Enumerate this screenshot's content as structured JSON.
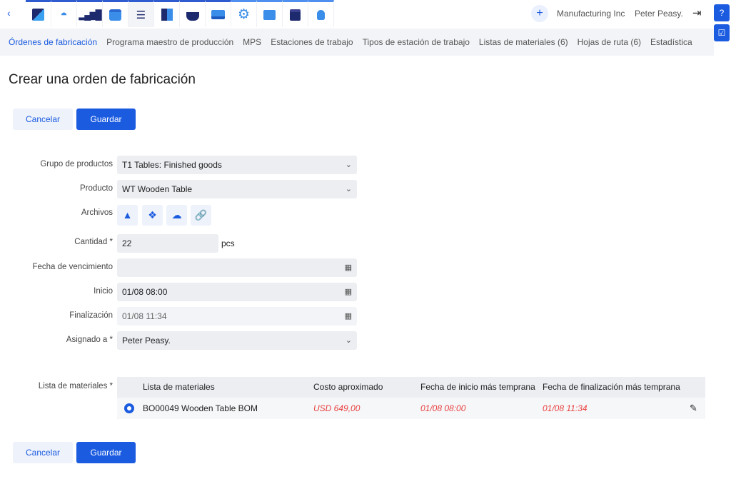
{
  "topbar": {
    "back_icon": "chevron-left-icon",
    "apps": [
      {
        "icon": "dashboard-square-icon",
        "glyph": "◩"
      },
      {
        "icon": "speedometer-icon",
        "glyph": "◔"
      },
      {
        "icon": "signal-bars-icon",
        "glyph": "📶"
      },
      {
        "icon": "calendar-icon",
        "glyph": "📅"
      },
      {
        "icon": "gantt-icon",
        "glyph": "☰"
      },
      {
        "icon": "cube-icon",
        "glyph": "⬛"
      },
      {
        "icon": "basket-icon",
        "glyph": "🧺"
      },
      {
        "icon": "folder-icon",
        "glyph": "📂"
      },
      {
        "icon": "gear-icon",
        "glyph": "⚙"
      },
      {
        "icon": "presentation-icon",
        "glyph": "📊"
      },
      {
        "icon": "gift-icon",
        "glyph": "🎁"
      },
      {
        "icon": "lightbulb-icon",
        "glyph": "💡"
      }
    ],
    "company": "Manufacturing Inc",
    "user": "Peter Peasy."
  },
  "nav": [
    "Órdenes de fabricación",
    "Programa maestro de producción",
    "MPS",
    "Estaciones de trabajo",
    "Tipos de estación de trabajo",
    "Listas de materiales (6)",
    "Hojas de ruta (6)",
    "Estadística"
  ],
  "title": "Crear una orden de fabricación",
  "buttons": {
    "cancel": "Cancelar",
    "save": "Guardar"
  },
  "form": {
    "product_group": {
      "label": "Grupo de productos",
      "value": "T1 Tables: Finished goods"
    },
    "product": {
      "label": "Producto",
      "value": "WT Wooden Table"
    },
    "files": {
      "label": "Archivos"
    },
    "quantity": {
      "label": "Cantidad *",
      "value": "22",
      "unit": "pcs"
    },
    "due_date": {
      "label": "Fecha de vencimiento",
      "value": ""
    },
    "start": {
      "label": "Inicio",
      "value": "01/08 08:00"
    },
    "finish": {
      "label": "Finalización",
      "value": "01/08 11:34"
    },
    "assigned": {
      "label": "Asignado a *",
      "value": "Peter Peasy."
    }
  },
  "bom": {
    "label": "Lista de materiales *",
    "headers": [
      "Lista de materiales",
      "Costo aproximado",
      "Fecha de inicio más temprana",
      "Fecha de finalización más temprana"
    ],
    "rows": [
      {
        "name": "BO00049 Wooden Table BOM",
        "cost": "USD 649,00",
        "start": "01/08 08:00",
        "finish": "01/08 11:34",
        "selected": true
      }
    ]
  },
  "colors": {
    "accent": "#1a5be0",
    "warning": "#e8413f"
  }
}
